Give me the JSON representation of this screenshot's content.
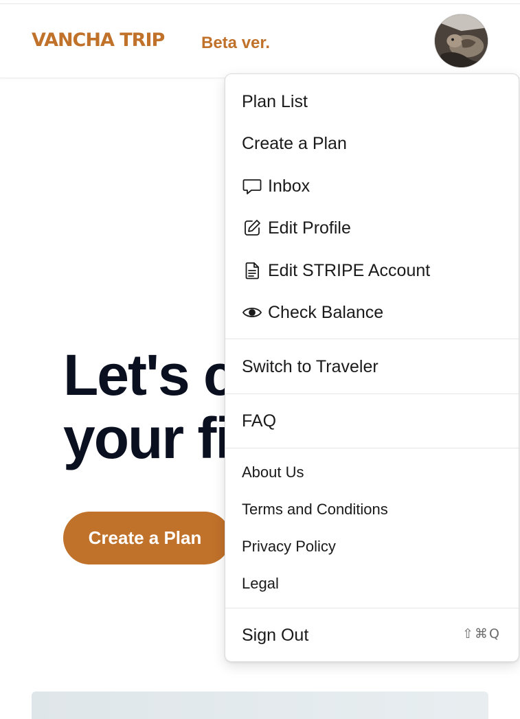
{
  "header": {
    "brand": "VANCHA TRIP",
    "beta_label": "Beta ver.",
    "avatar_alt": "User avatar"
  },
  "hero": {
    "title_line1": "Let's c",
    "title_line2": "your fi",
    "cta_label": "Create a Plan"
  },
  "menu": {
    "primary": [
      {
        "label": "Plan List",
        "icon": null
      },
      {
        "label": "Create a Plan",
        "icon": null
      },
      {
        "label": "Inbox",
        "icon": "chat-bubble-icon"
      },
      {
        "label": "Edit Profile",
        "icon": "edit-icon"
      },
      {
        "label": "Edit STRIPE Account",
        "icon": "document-icon"
      },
      {
        "label": "Check Balance",
        "icon": "eye-icon"
      }
    ],
    "switch_label": "Switch to Traveler",
    "faq_label": "FAQ",
    "info": [
      {
        "label": "About Us"
      },
      {
        "label": "Terms and Conditions"
      },
      {
        "label": "Privacy Policy"
      },
      {
        "label": "Legal"
      }
    ],
    "sign_out_label": "Sign Out",
    "sign_out_shortcut": "⇧⌘Q"
  },
  "colors": {
    "brand": "#c0712a",
    "cta_background": "#c0712a",
    "hero_text": "#0b1020"
  }
}
